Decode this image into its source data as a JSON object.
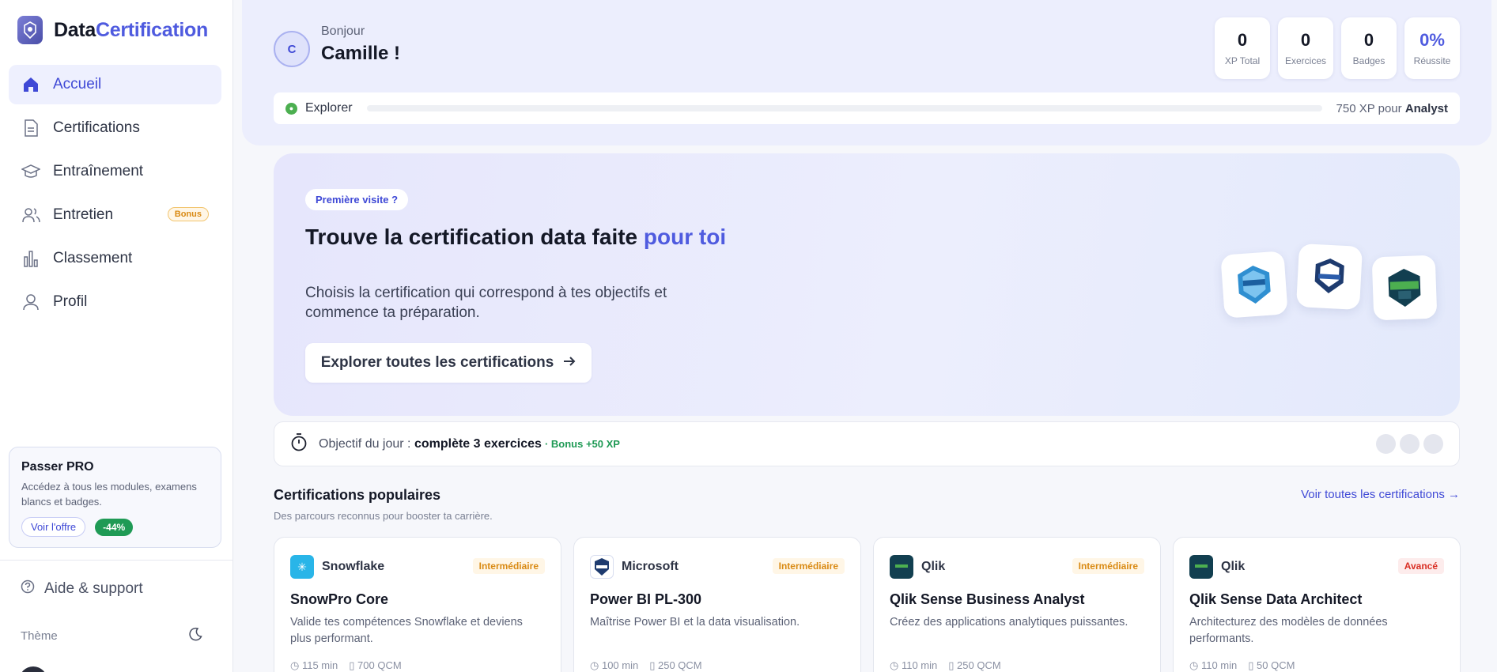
{
  "brand": {
    "part1": "Data",
    "part2": "Certification"
  },
  "nav": [
    {
      "label": "Accueil",
      "icon": "home-icon",
      "active": true
    },
    {
      "label": "Certifications",
      "icon": "document-icon"
    },
    {
      "label": "Entraînement",
      "icon": "graduation-cap-icon"
    },
    {
      "label": "Entretien",
      "icon": "users-icon",
      "badge": "Bonus"
    },
    {
      "label": "Classement",
      "icon": "bar-chart-icon"
    },
    {
      "label": "Profil",
      "icon": "user-icon"
    }
  ],
  "pro": {
    "title": "Passer PRO",
    "desc": "Accédez à tous les modules, examens blancs et badges.",
    "cta": "Voir l'offre",
    "discount": "-44%"
  },
  "help": {
    "label": "Aide & support"
  },
  "theme": {
    "label": "Thème"
  },
  "header": {
    "avatar_initial": "C",
    "greeting": "Bonjour",
    "name": "Camille !",
    "stats": [
      {
        "value": "0",
        "label": "XP Total"
      },
      {
        "value": "0",
        "label": "Exercices"
      },
      {
        "value": "0",
        "label": "Badges"
      },
      {
        "value": "0%",
        "label": "Réussite"
      }
    ],
    "level": {
      "name": "Explorer",
      "progress": 0,
      "info_prefix": "750 XP pour",
      "next_level": "Analyst"
    }
  },
  "hero": {
    "tag": "Première visite ?",
    "title_main": "Trouve la certification data faite ",
    "title_accent": "pour toi",
    "desc": "Choisis la certification qui correspond à tes objectifs et commence ta préparation.",
    "cta": "Explorer toutes les certifications"
  },
  "objective": {
    "prefix": "Objectif du jour : ",
    "goal": "complète 3 exercices",
    "bonus": "· Bonus +50 XP"
  },
  "popular": {
    "title": "Certifications populaires",
    "subtitle": "Des parcours reconnus pour booster ta carrière.",
    "link": "Voir toutes les certifications →",
    "cards": [
      {
        "provider": "Snowflake",
        "level": "Intermédiaire",
        "title": "SnowPro Core",
        "desc": "Valide tes compétences Snowflake et deviens plus performant.",
        "duration": "115 min",
        "qcm": "700 QCM"
      },
      {
        "provider": "Microsoft",
        "level": "Intermédiaire",
        "title": "Power BI PL-300",
        "desc": "Maîtrise Power BI et la data visualisation.",
        "duration": "100 min",
        "qcm": "250 QCM"
      },
      {
        "provider": "Qlik",
        "level": "Intermédiaire",
        "title": "Qlik Sense Business Analyst",
        "desc": "Créez des applications analytiques puissantes.",
        "duration": "110 min",
        "qcm": "250 QCM"
      },
      {
        "provider": "Qlik",
        "level": "Avancé",
        "title": "Qlik Sense Data Architect",
        "desc": "Architecturez des modèles de données performants.",
        "duration": "110 min",
        "qcm": "50 QCM"
      }
    ]
  }
}
